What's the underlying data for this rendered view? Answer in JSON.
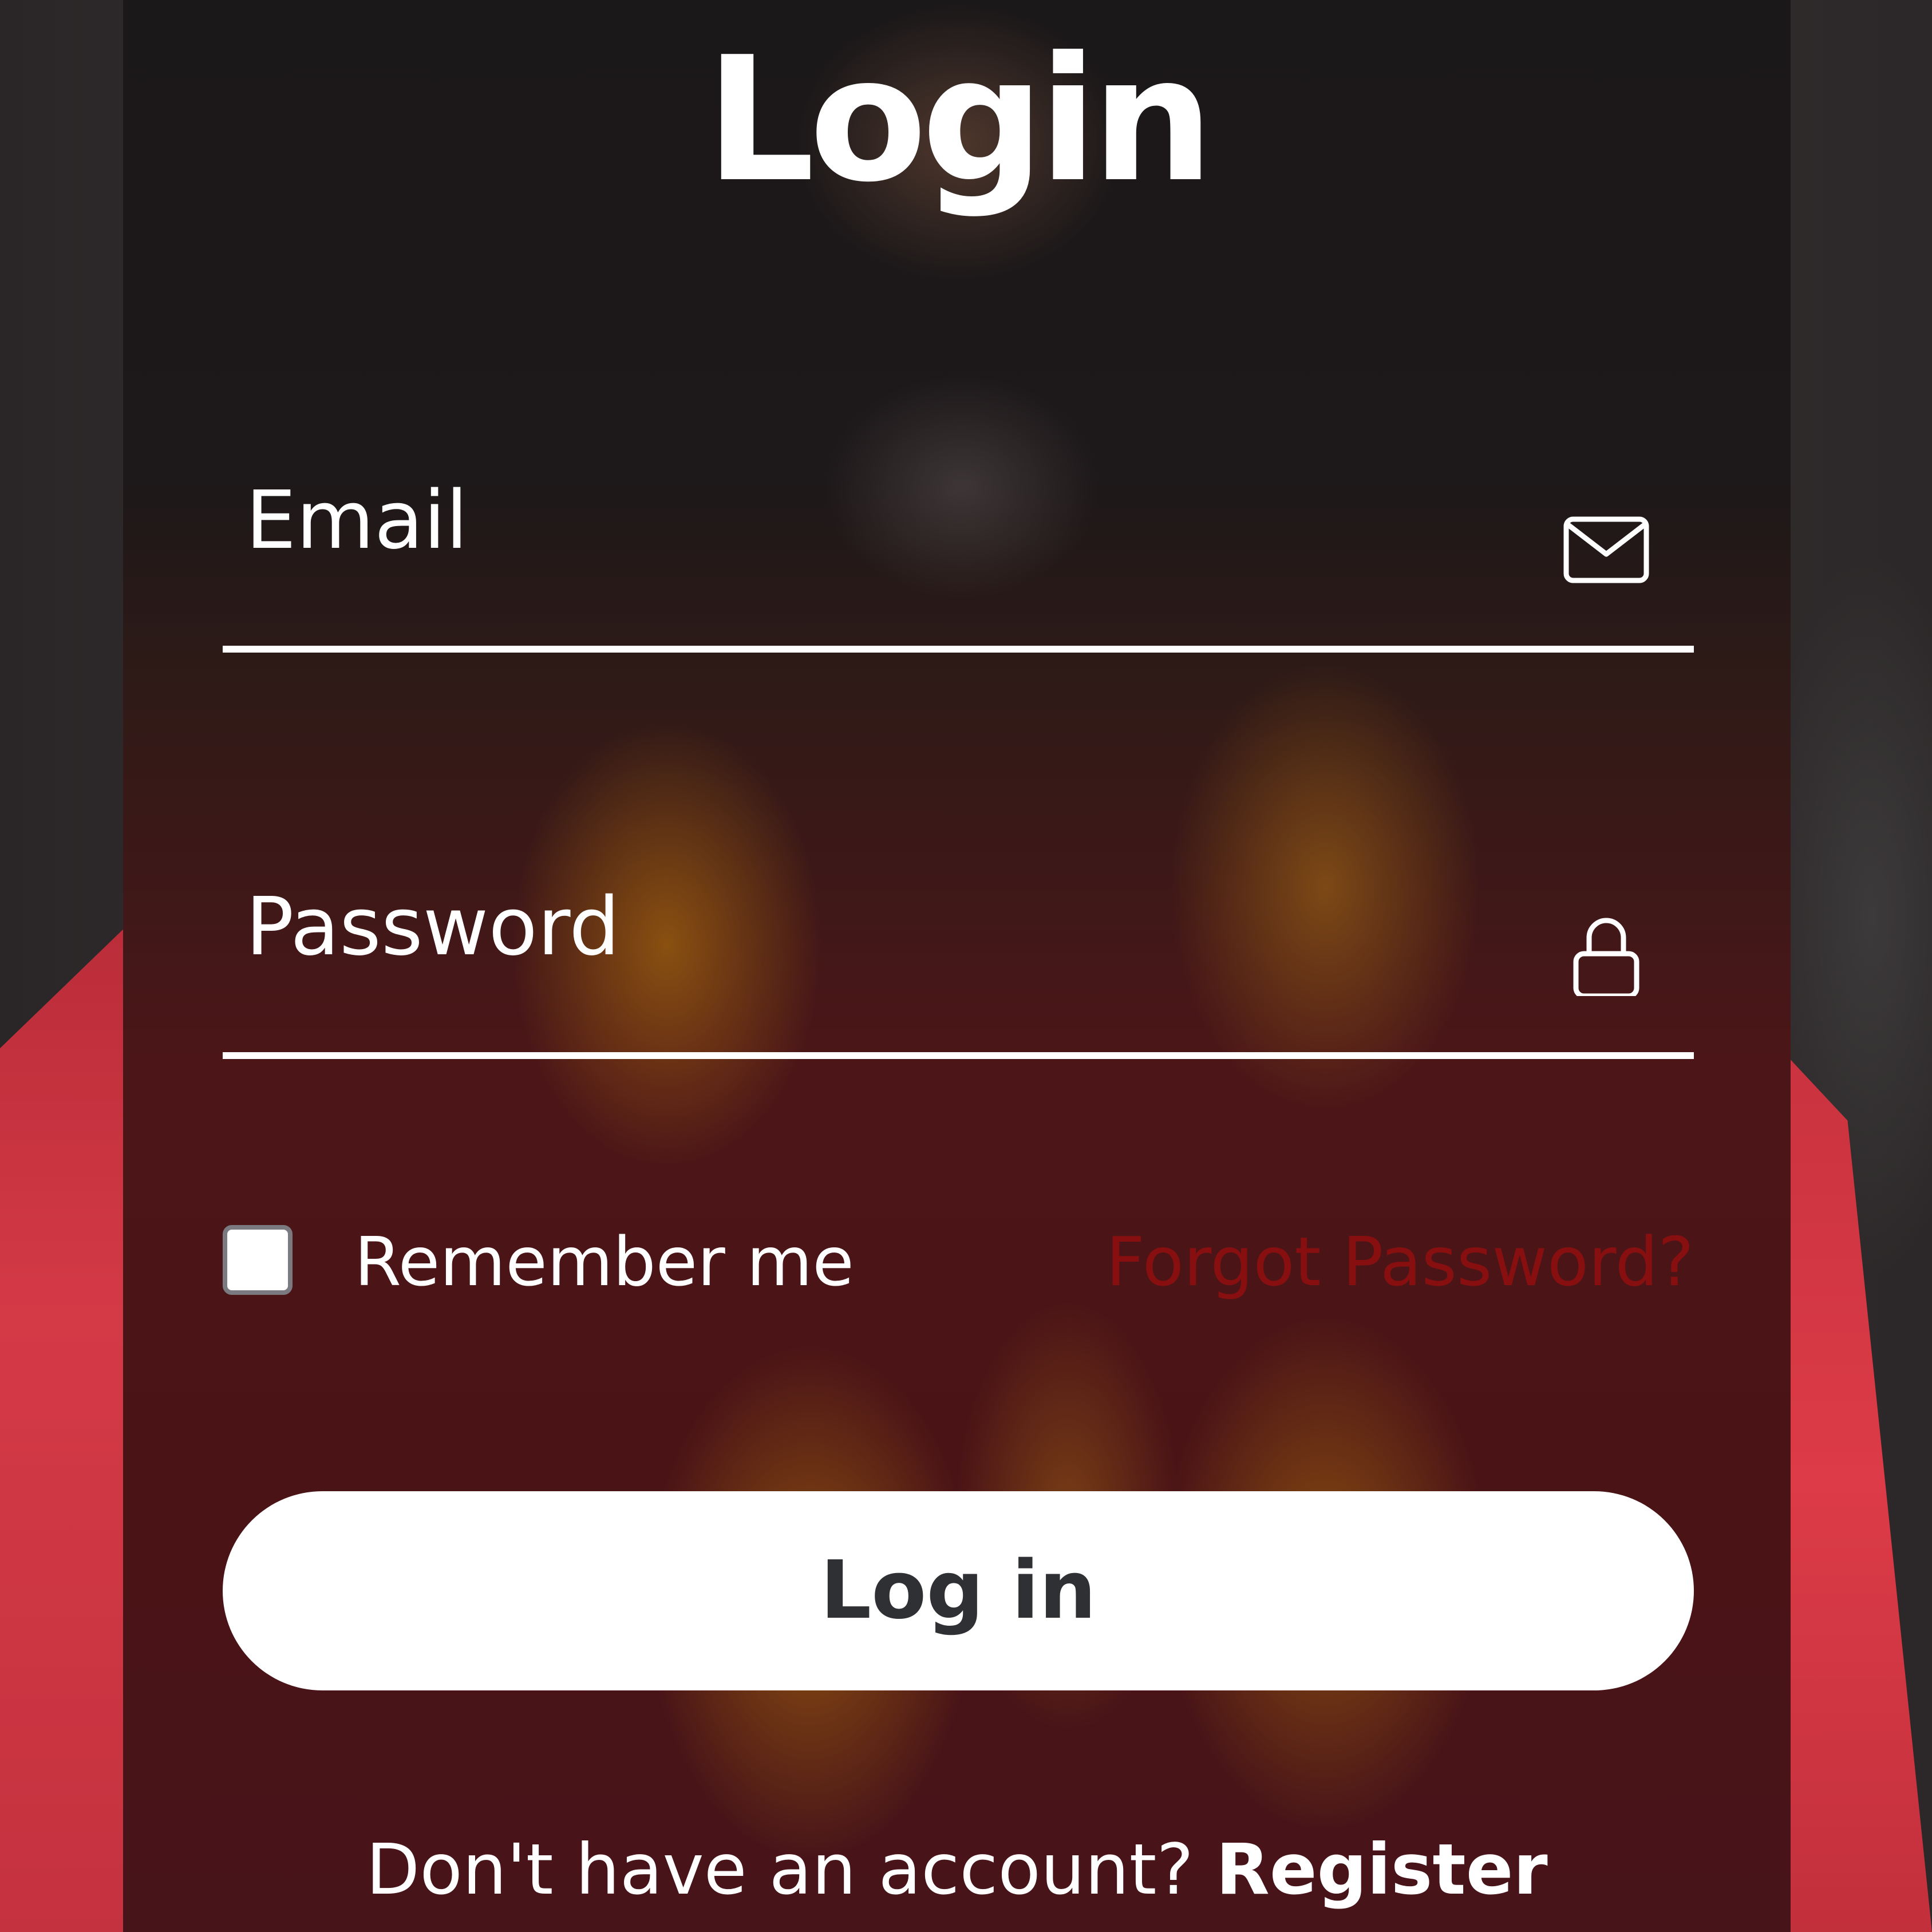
{
  "form": {
    "title": "Login",
    "email": {
      "placeholder": "Email",
      "icon": "envelope-icon"
    },
    "password": {
      "placeholder": "Password",
      "icon": "lock-icon"
    },
    "remember_label": "Remember me",
    "remember_checked": false,
    "forgot_label": "Forgot Password?",
    "submit_label": "Log in",
    "footer_prompt": "Don't have an account?",
    "register_label": "Register"
  },
  "colors": {
    "accent_link": "#880f10",
    "button_bg": "#ffffff",
    "button_text": "#2f3033",
    "text": "#ffffff"
  }
}
